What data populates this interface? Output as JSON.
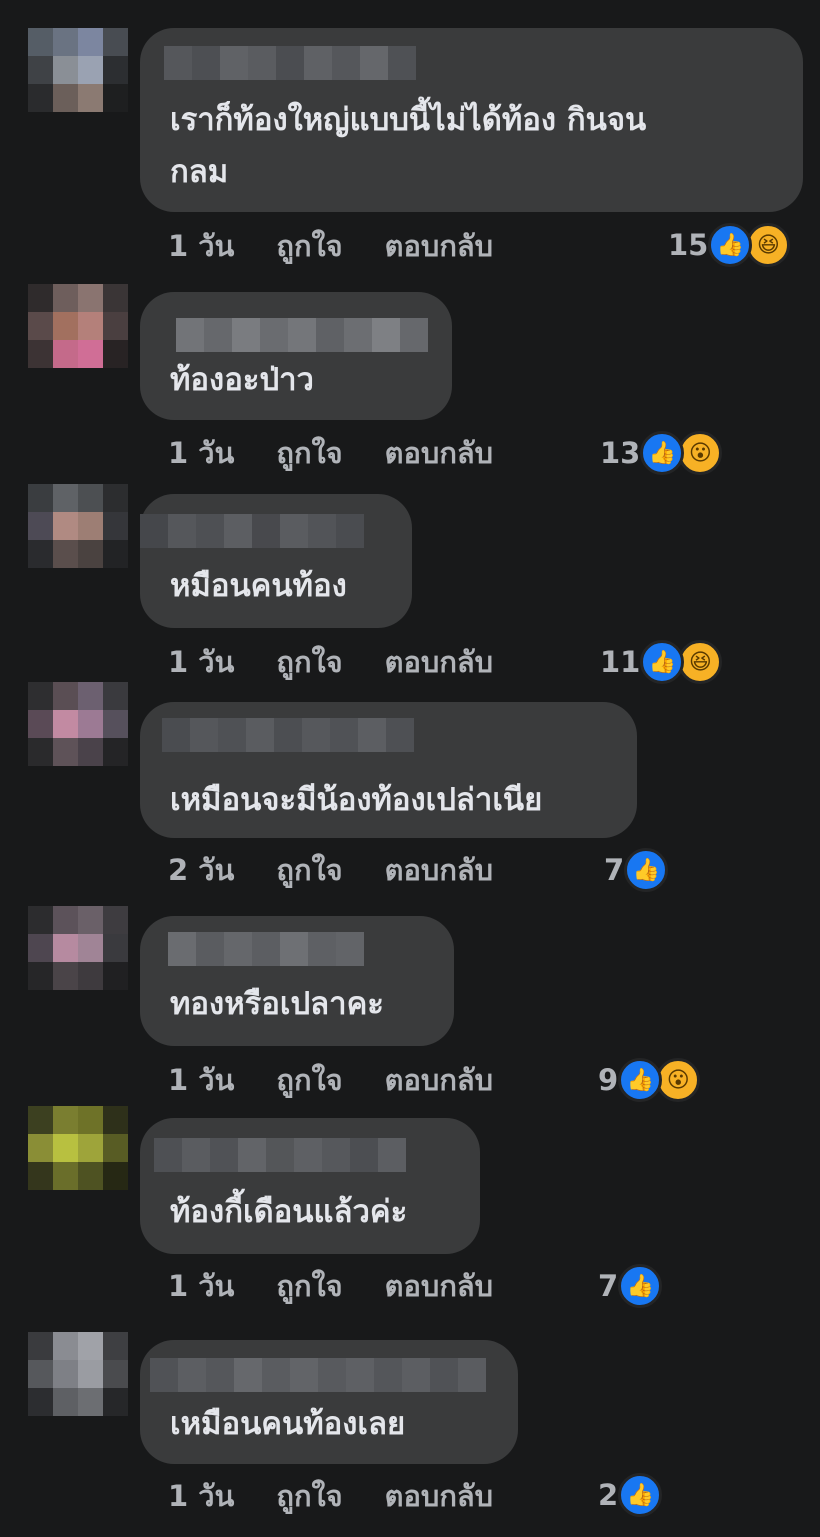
{
  "comments": [
    {
      "text": "เราก็ท้องใหญ่แบบนี้ไม่ได้ท้อง กินจน\nกลม",
      "time": "1 วัน",
      "like": "ถูกใจ",
      "reply": "ตอบกลับ",
      "count": "15",
      "reaction": "haha"
    },
    {
      "text": "ท้องอะป่าว",
      "time": "1 วัน",
      "like": "ถูกใจ",
      "reply": "ตอบกลับ",
      "count": "13",
      "reaction": "wow"
    },
    {
      "text": "หมือนคนท้อง",
      "time": "1 วัน",
      "like": "ถูกใจ",
      "reply": "ตอบกลับ",
      "count": "11",
      "reaction": "haha"
    },
    {
      "text": "เหมือนจะมีน้องท้องเปล่าเนีย",
      "time": "2 วัน",
      "like": "ถูกใจ",
      "reply": "ตอบกลับ",
      "count": "7",
      "reaction": "none"
    },
    {
      "text": "ทองหรือเปลาคะ",
      "time": "1 วัน",
      "like": "ถูกใจ",
      "reply": "ตอบกลับ",
      "count": "9",
      "reaction": "wow"
    },
    {
      "text": "ท้องกี้เดือนแล้วค่ะ",
      "time": "1 วัน",
      "like": "ถูกใจ",
      "reply": "ตอบกลับ",
      "count": "7",
      "reaction": "none"
    },
    {
      "text": "เหมือนคนท้องเลย",
      "time": "1 วัน",
      "like": "ถูกใจ",
      "reply": "ตอบกลับ",
      "count": "2",
      "reaction": "none"
    }
  ],
  "icons": {
    "like": "thumbs-up-icon",
    "haha": "laughing-face-icon",
    "wow": "surprised-face-icon"
  },
  "colors": {
    "background": "#18191a",
    "bubble": "#3a3b3c",
    "text": "#e4e6eb",
    "meta": "#b0b3b8",
    "like_blue": "#1877f2",
    "emoji_yellow": "#f7b125"
  }
}
